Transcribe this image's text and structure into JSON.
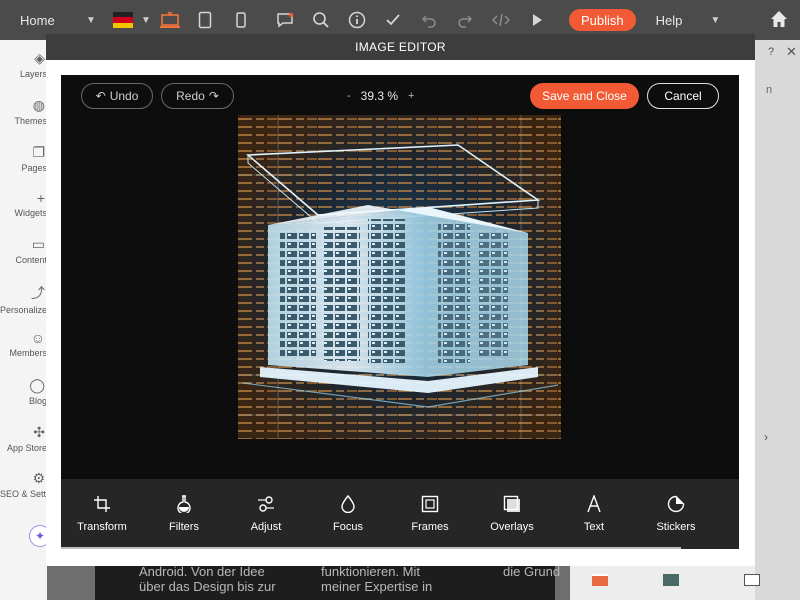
{
  "topbar": {
    "page_select": "Home",
    "publish_label": "Publish",
    "help_label": "Help",
    "icons": [
      "flag-de",
      "desktop-icon",
      "tablet-icon",
      "mobile-icon",
      "comment-icon",
      "search-icon",
      "info-icon",
      "check-icon",
      "undo-icon",
      "redo-icon",
      "code-icon",
      "play-icon"
    ]
  },
  "sidebar": {
    "items": [
      {
        "label": "Layers",
        "icon": "layers-icon"
      },
      {
        "label": "Themes",
        "icon": "palette-icon"
      },
      {
        "label": "Pages",
        "icon": "pages-icon"
      },
      {
        "label": "Widgets",
        "icon": "plus-icon"
      },
      {
        "label": "Content",
        "icon": "folder-icon"
      },
      {
        "label": "Personalize",
        "icon": "personalize-icon"
      },
      {
        "label": "Members",
        "icon": "members-icon"
      },
      {
        "label": "Blog",
        "icon": "chat-icon"
      },
      {
        "label": "App Store",
        "icon": "puzzle-icon"
      },
      {
        "label": "SEO & Settings",
        "icon": "gear-icon"
      }
    ]
  },
  "background": {
    "col1": "Android. Von der Idee\nüber das Design bis zur",
    "col2": "funktionieren. Mit\nmeiner Expertise in",
    "col3": "die Grund",
    "right_n": "n"
  },
  "modal": {
    "title": "IMAGE EDITOR",
    "undo_label": "Undo",
    "redo_label": "Redo",
    "zoom_minus": "-",
    "zoom_value": "39.3 %",
    "zoom_plus": "+",
    "save_label": "Save and Close",
    "cancel_label": "Cancel",
    "tools": [
      {
        "label": "Transform",
        "icon": "crop-icon"
      },
      {
        "label": "Filters",
        "icon": "flask-icon"
      },
      {
        "label": "Adjust",
        "icon": "adjust-icon"
      },
      {
        "label": "Focus",
        "icon": "drop-icon"
      },
      {
        "label": "Frames",
        "icon": "frame-icon"
      },
      {
        "label": "Overlays",
        "icon": "overlay-icon"
      },
      {
        "label": "Text",
        "icon": "text-icon"
      },
      {
        "label": "Stickers",
        "icon": "sticker-icon"
      }
    ]
  },
  "colors": {
    "accent": "#f15a35",
    "topbar": "#4b4b4b",
    "editor_bg": "#0d0d0d",
    "toolbar_bg": "#262626"
  }
}
